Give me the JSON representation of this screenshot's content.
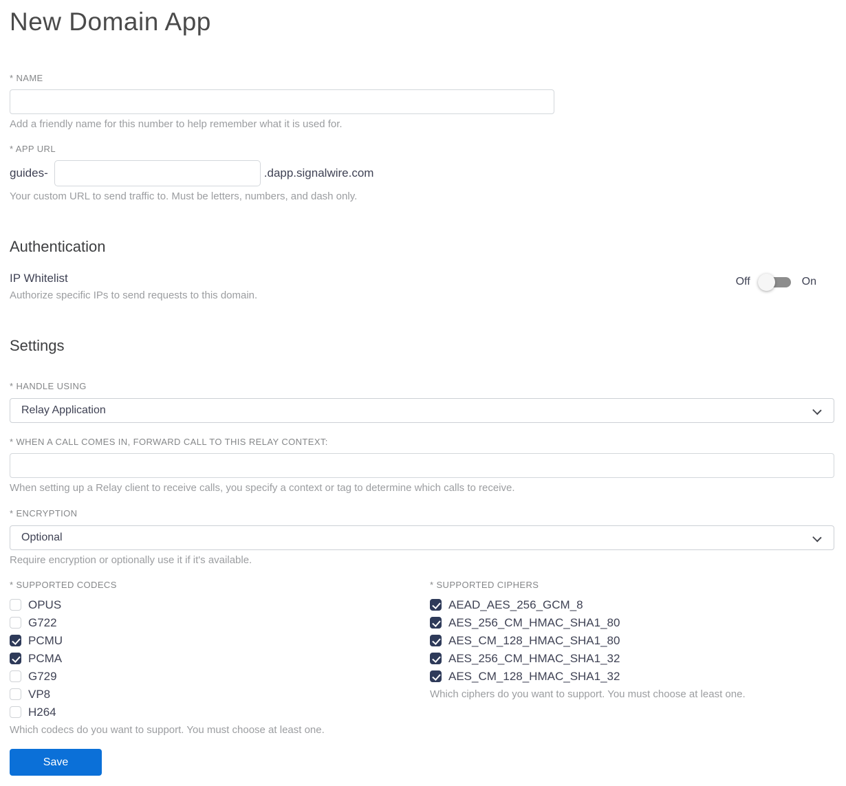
{
  "page": {
    "title": "New Domain App"
  },
  "colors": {
    "save_button": "#0b70d8",
    "checkbox_checked": "#2e3a59",
    "toggle_track": "#8d8d8d",
    "label_gray": "#858789",
    "help_gray": "#9b9da0",
    "body_text": "#3f4254"
  },
  "name_field": {
    "label": "* NAME",
    "value": "",
    "help": "Add a friendly name for this number to help remember what it is used for."
  },
  "app_url_field": {
    "label": "* APP URL",
    "prefix": "guides-",
    "value": "",
    "suffix": ".dapp.signalwire.com",
    "help": "Your custom URL to send traffic to. Must be letters, numbers, and dash only."
  },
  "authentication": {
    "heading": "Authentication",
    "ip_whitelist": {
      "label": "IP Whitelist",
      "description": "Authorize specific IPs to send requests to this domain.",
      "off_label": "Off",
      "on_label": "On",
      "enabled": false
    }
  },
  "settings": {
    "heading": "Settings",
    "handle_using": {
      "label": "* HANDLE USING",
      "selected": "Relay Application"
    },
    "relay_context": {
      "label": "* WHEN A CALL COMES IN, FORWARD CALL TO THIS RELAY CONTEXT:",
      "value": "",
      "help": "When setting up a Relay client to receive calls, you specify a context or tag to determine which calls to receive."
    },
    "encryption": {
      "label": "* ENCRYPTION",
      "selected": "Optional",
      "help": "Require encryption or optionally use it if it's available."
    },
    "codecs": {
      "label": "* SUPPORTED CODECS",
      "options": [
        {
          "label": "OPUS",
          "checked": false
        },
        {
          "label": "G722",
          "checked": false
        },
        {
          "label": "PCMU",
          "checked": true
        },
        {
          "label": "PCMA",
          "checked": true
        },
        {
          "label": "G729",
          "checked": false
        },
        {
          "label": "VP8",
          "checked": false
        },
        {
          "label": "H264",
          "checked": false
        }
      ],
      "help": "Which codecs do you want to support. You must choose at least one."
    },
    "ciphers": {
      "label": "* SUPPORTED CIPHERS",
      "options": [
        {
          "label": "AEAD_AES_256_GCM_8",
          "checked": true
        },
        {
          "label": "AES_256_CM_HMAC_SHA1_80",
          "checked": true
        },
        {
          "label": "AES_CM_128_HMAC_SHA1_80",
          "checked": true
        },
        {
          "label": "AES_256_CM_HMAC_SHA1_32",
          "checked": true
        },
        {
          "label": "AES_CM_128_HMAC_SHA1_32",
          "checked": true
        }
      ],
      "help": "Which ciphers do you want to support. You must choose at least one."
    }
  },
  "actions": {
    "save_label": "Save"
  }
}
